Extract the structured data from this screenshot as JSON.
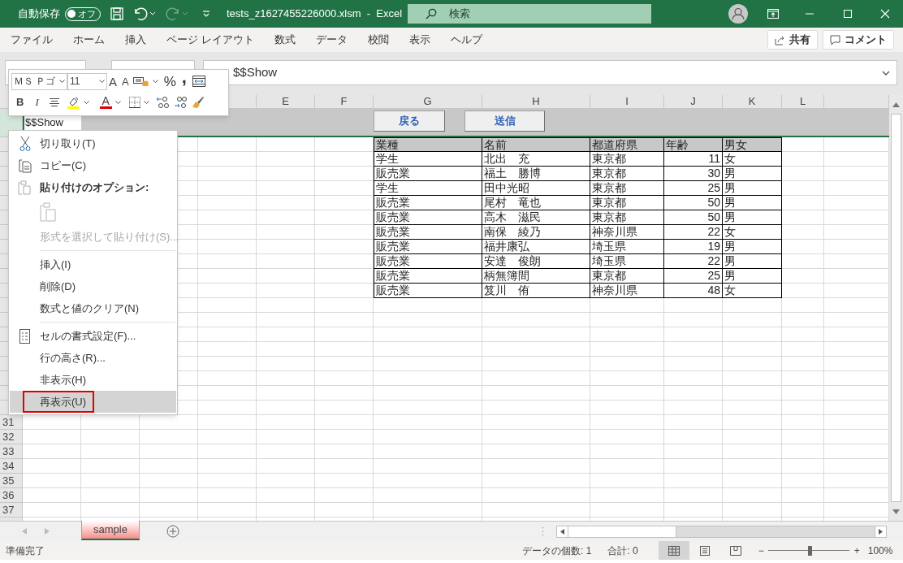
{
  "title_bar": {
    "autosave_label": "自動保存",
    "autosave_toggle": {
      "label": "オフ",
      "on": false
    },
    "document_title": "tests_z1627455226000.xlsm  -  Excel",
    "search": {
      "placeholder": "検索"
    }
  },
  "ribbon_tabs": [
    "ファイル",
    "ホーム",
    "挿入",
    "ページ レイアウト",
    "数式",
    "データ",
    "校閲",
    "表示",
    "ヘルプ"
  ],
  "ribbon_buttons": [
    "共有",
    "コメント"
  ],
  "formula_bar": {
    "value": "$$Show"
  },
  "mini_toolbar": {
    "font": "ＭＳ Ｐゴ",
    "size": "11",
    "grow_font": "A",
    "shrink_font": "A",
    "percent": "%",
    "comma": ",",
    "bold": "B",
    "italic": "I",
    "font_color": "A"
  },
  "column_headers": [
    "E",
    "F",
    "G",
    "H",
    "I",
    "J",
    "K",
    "L"
  ],
  "row_headers": [
    "31",
    "32",
    "33",
    "34",
    "35",
    "36",
    "37"
  ],
  "active_cell": "$$Show",
  "sheet_buttons": [
    "戻る",
    "送信"
  ],
  "table": {
    "columns": [
      "業種",
      "名前",
      "都道府県",
      "年齢",
      "男女"
    ],
    "rows": [
      [
        "学生",
        "北出　充",
        "東京都",
        "11",
        "女"
      ],
      [
        "販売業",
        "福土　勝博",
        "東京都",
        "30",
        "男"
      ],
      [
        "学生",
        "田中光昭",
        "東京都",
        "25",
        "男"
      ],
      [
        "販売業",
        "尾村　竜也",
        "東京都",
        "50",
        "男"
      ],
      [
        "販売業",
        "高木　滋民",
        "東京都",
        "50",
        "男"
      ],
      [
        "販売業",
        "南保　綾乃",
        "神奈川県",
        "22",
        "女"
      ],
      [
        "販売業",
        "福井康弘",
        "埼玉県",
        "19",
        "男"
      ],
      [
        "販売業",
        "安達　俊朗",
        "埼玉県",
        "22",
        "男"
      ],
      [
        "販売業",
        "柄無簿間",
        "東京都",
        "25",
        "男"
      ],
      [
        "販売業",
        "笈川　侑",
        "神奈川県",
        "48",
        "女"
      ]
    ]
  },
  "context_menu": {
    "items": [
      {
        "kind": "command",
        "label": "切り取り(T)",
        "disabled": false,
        "selected": false
      },
      {
        "kind": "command",
        "label": "コピー(C)",
        "disabled": false,
        "selected": false
      },
      {
        "kind": "heading",
        "label": "貼り付けのオプション:"
      },
      {
        "kind": "paste_option",
        "disabled": true
      },
      {
        "kind": "command",
        "label": "形式を選択して貼り付け(S)...",
        "disabled": true,
        "selected": false
      },
      {
        "kind": "separator"
      },
      {
        "kind": "command",
        "label": "挿入(I)",
        "disabled": false,
        "selected": false
      },
      {
        "kind": "command",
        "label": "削除(D)",
        "disabled": false,
        "selected": false
      },
      {
        "kind": "command",
        "label": "数式と値のクリア(N)",
        "disabled": false,
        "selected": false
      },
      {
        "kind": "separator"
      },
      {
        "kind": "command",
        "label": "セルの書式設定(F)...",
        "disabled": false,
        "selected": false
      },
      {
        "kind": "command",
        "label": "行の高さ(R)...",
        "disabled": false,
        "selected": false
      },
      {
        "kind": "command",
        "label": "非表示(H)",
        "disabled": false,
        "selected": false
      },
      {
        "kind": "command",
        "label": "再表示(U)",
        "disabled": false,
        "selected": true
      }
    ]
  },
  "sheet_tabs": [
    {
      "label": "sample",
      "selected": true
    }
  ],
  "status_bar": {
    "status": "準備完了",
    "count": "データの個数: 1",
    "sum": "合計: 0",
    "views": [
      {
        "selected": true
      },
      {
        "selected": false
      },
      {
        "selected": false
      }
    ],
    "zoom": {
      "level": 0.51,
      "minus": "−",
      "plus": "+",
      "reading": "100%"
    }
  }
}
